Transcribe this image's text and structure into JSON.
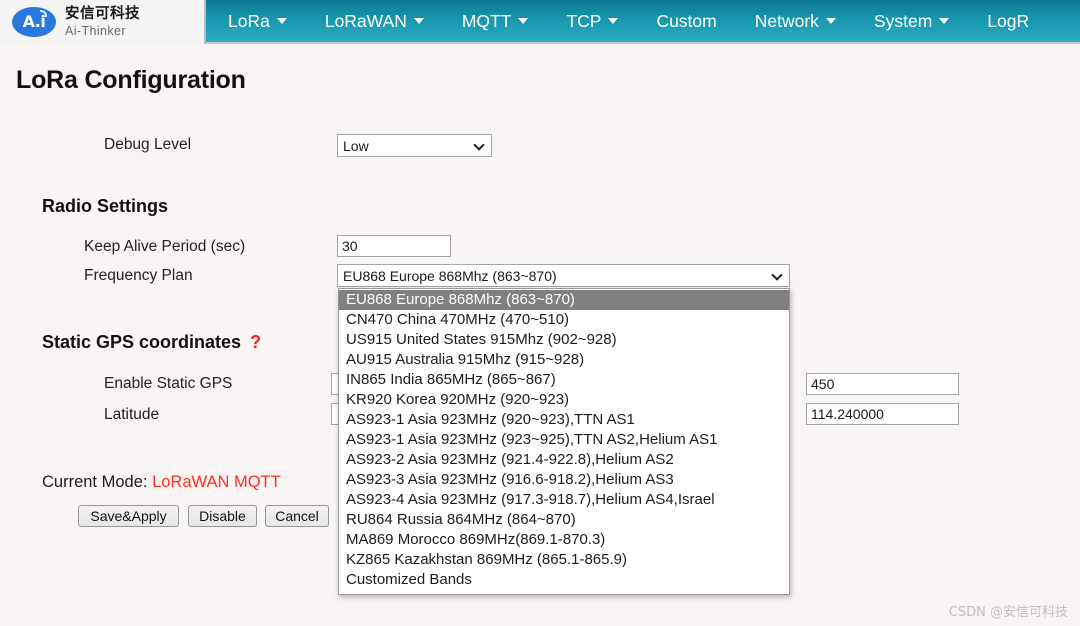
{
  "header": {
    "brand": {
      "logo_glyph": "A.i",
      "name_cn": "安信可科技",
      "name_en": "Ai-Thinker"
    },
    "nav_items": [
      {
        "label": "LoRa",
        "has_caret": true
      },
      {
        "label": "LoRaWAN",
        "has_caret": true
      },
      {
        "label": "MQTT",
        "has_caret": true
      },
      {
        "label": "TCP",
        "has_caret": true
      },
      {
        "label": "Custom",
        "has_caret": false
      },
      {
        "label": "Network",
        "has_caret": true
      },
      {
        "label": "System",
        "has_caret": true
      },
      {
        "label": "LogR",
        "has_caret": false
      }
    ]
  },
  "page": {
    "title": "LoRa Configuration"
  },
  "form": {
    "debug_level": {
      "label": "Debug Level",
      "value": "Low"
    },
    "radio_settings": {
      "heading": "Radio Settings",
      "keep_alive": {
        "label": "Keep Alive Period (sec)",
        "value": "30"
      },
      "frequency_plan": {
        "label": "Frequency Plan",
        "value": "EU868 Europe 868Mhz (863~870)"
      }
    },
    "static_gps": {
      "heading": "Static GPS coordinates",
      "help_mark": "?",
      "enable_label": "Enable Static GPS",
      "latitude_label": "Latitude",
      "altitude_value": "450",
      "longitude_value": "114.240000"
    }
  },
  "dropdown": {
    "selected_index": 0,
    "options": [
      "EU868 Europe 868Mhz (863~870)",
      "CN470 China 470MHz (470~510)",
      "US915 United States 915Mhz (902~928)",
      "AU915 Australia 915Mhz (915~928)",
      "IN865 India 865MHz (865~867)",
      "KR920 Korea 920MHz (920~923)",
      "AS923-1 Asia 923MHz (920~923),TTN AS1",
      "AS923-1 Asia 923MHz (923~925),TTN AS2,Helium AS1",
      "AS923-2 Asia 923MHz (921.4-922.8),Helium AS2",
      "AS923-3 Asia 923MHz (916.6-918.2),Helium AS3",
      "AS923-4 Asia 923MHz (917.3-918.7),Helium AS4,Israel",
      "RU864 Russia 864MHz (864~870)",
      "MA869 Morocco 869MHz(869.1-870.3)",
      "KZ865 Kazakhstan 869MHz (865.1-865.9)",
      "Customized Bands"
    ]
  },
  "footer": {
    "current_mode_label": "Current Mode:",
    "current_mode_value": "LoRaWAN MQTT",
    "buttons": [
      {
        "label": "Save&Apply"
      },
      {
        "label": "Disable"
      },
      {
        "label": "Cancel"
      }
    ],
    "watermark": "CSDN @安信可科技"
  }
}
